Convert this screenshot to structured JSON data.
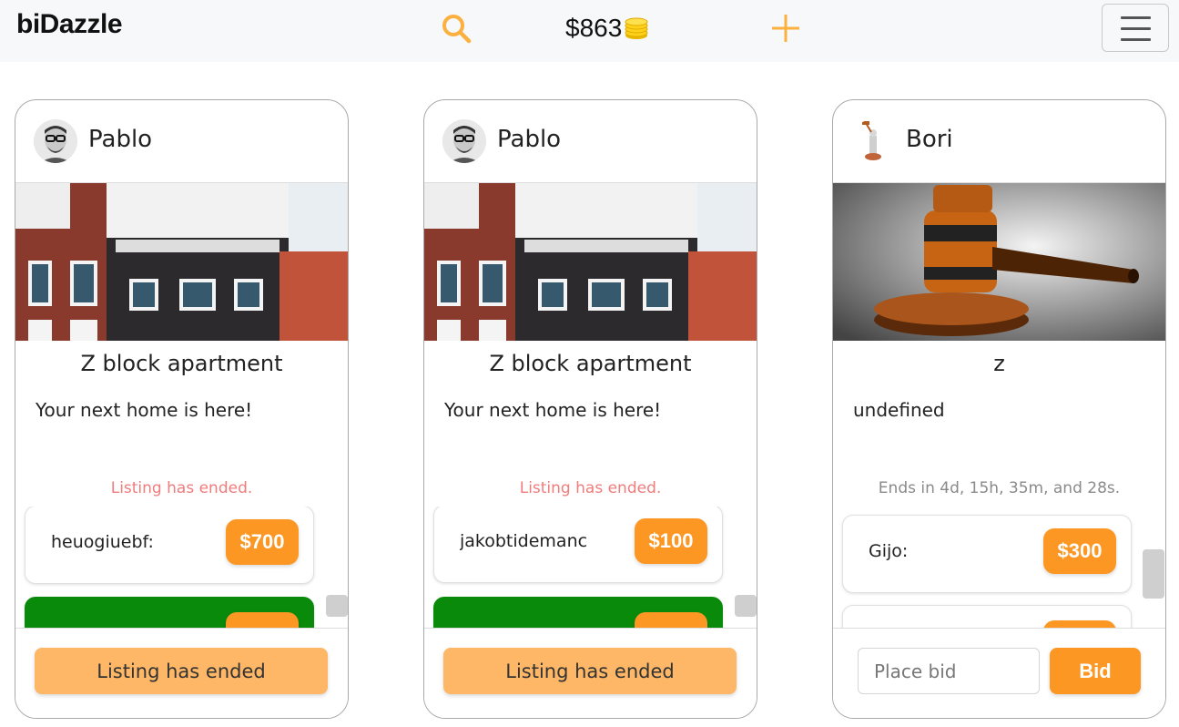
{
  "header": {
    "logo": "biDazzle",
    "balance": "$863",
    "icons": {
      "search": "search-icon",
      "coins": "coins-icon",
      "add": "plus-icon",
      "menu": "hamburger-menu-icon"
    },
    "accent_color": "#fb9722"
  },
  "listings": [
    {
      "seller": "Pablo",
      "title": "Z block apartment",
      "description": "Your next home is here!",
      "status": "Listing has ended.",
      "bids": [
        {
          "bidder": "heuogiuebf:",
          "amount": "$700"
        },
        {
          "bidder": "",
          "amount": ""
        }
      ],
      "footer_label": "Listing has ended"
    },
    {
      "seller": "Pablo",
      "title": "Z block apartment",
      "description": "Your next home is here!",
      "status": "Listing has ended.",
      "bids": [
        {
          "bidder": "jakobtidemanc",
          "amount": "$100"
        },
        {
          "bidder": "",
          "amount": ""
        }
      ],
      "footer_label": "Listing has ended"
    },
    {
      "seller": "Bori",
      "title": "z",
      "description": "undefined",
      "status": "Ends in 4d, 15h, 35m, and 28s.",
      "bids": [
        {
          "bidder": "Gijo:",
          "amount": "$300"
        },
        {
          "bidder": "",
          "amount": ""
        }
      ],
      "bid_placeholder": "Place bid",
      "bid_button": "Bid"
    }
  ],
  "colors": {
    "won_bid": "#0a8a0a",
    "ended_status": "#f07c7c",
    "ended_button": "#fdb767"
  }
}
